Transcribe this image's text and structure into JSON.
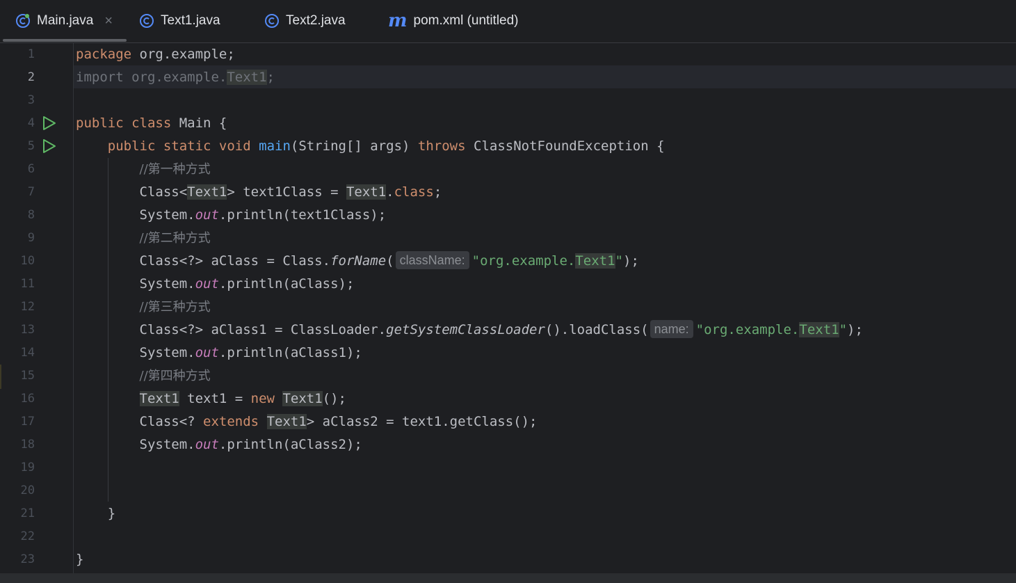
{
  "tabs": [
    {
      "label": "Main.java",
      "icon": "java-class-icon",
      "active": true,
      "close": "×"
    },
    {
      "label": "Text1.java",
      "icon": "java-class-icon"
    },
    {
      "label": "Text2.java",
      "icon": "java-class-icon"
    },
    {
      "label": "pom.xml (untitled)",
      "icon": "maven-m-icon",
      "icon_glyph": "m"
    }
  ],
  "editor": {
    "current_line": 2,
    "line_numbers": [
      "1",
      "2",
      "3",
      "4",
      "5",
      "6",
      "7",
      "8",
      "9",
      "10",
      "11",
      "12",
      "13",
      "14",
      "15",
      "16",
      "17",
      "18",
      "19",
      "20",
      "21",
      "22",
      "23"
    ],
    "code": {
      "l1_kw": "package",
      "l1_rest": " org.example;",
      "l2_a": "import org.example.",
      "l2_b": "Text1",
      "l2_c": ";",
      "l4_kw": "public class",
      "l4_rest": " Main {",
      "l5_indent": "    ",
      "l5_kw": "public static void",
      "l5_sp": " ",
      "l5_fn": "main",
      "l5_mid": "(String[] args) ",
      "l5_kw2": "throws",
      "l5_rest": " ClassNotFoundException {",
      "indent": "        ",
      "l6_cmt": "//第一种方式",
      "l7_a": "Class<",
      "l7_b": "Text1",
      "l7_c": "> text1Class = ",
      "l7_d": "Text1",
      "l7_e": ".",
      "l7_kw": "class",
      "l7_f": ";",
      "sys": "System.",
      "out": "out",
      "l8_rest": ".println(text1Class);",
      "l9_cmt": "//第二种方式",
      "l10_a": "Class<?> aClass = Class.",
      "l10_fn": "forName",
      "l10_b": "(",
      "l10_hint": "className:",
      "l10_st1": "\"org.example.",
      "l10_st2": "Text1",
      "l10_st3": "\"",
      "l10_c": ");",
      "l11_rest": ".println(aClass);",
      "l12_cmt": "//第三种方式",
      "l13_a": "Class<?> aClass1 = ClassLoader.",
      "l13_fn": "getSystemClassLoader",
      "l13_b": "().loadClass(",
      "l13_hint": "name:",
      "l13_st1": "\"org.example.",
      "l13_st2": "Text1",
      "l13_st3": "\"",
      "l13_c": ");",
      "l14_rest": ".println(aClass1);",
      "l15_cmt": "//第四种方式",
      "l16_a": "Text1",
      "l16_b": " text1 = ",
      "l16_kw": "new",
      "l16_sp": " ",
      "l16_c": "Text1",
      "l16_d": "();",
      "l17_a": "Class<? ",
      "l17_kw": "extends",
      "l17_sp": " ",
      "l17_b": "Text1",
      "l17_c": "> aClass2 = text1.getClass();",
      "l18_rest": ".println(aClass2);",
      "l21": "    }",
      "l23": "}"
    }
  },
  "colors": {
    "background": "#1e1f22",
    "keyword": "#cf8e6d",
    "function": "#56a8f5",
    "string": "#6aab73",
    "static_field": "#c77dbb",
    "comment": "#7a7e85",
    "run_icon": "#5fb865",
    "class_icon": "#548af7"
  }
}
